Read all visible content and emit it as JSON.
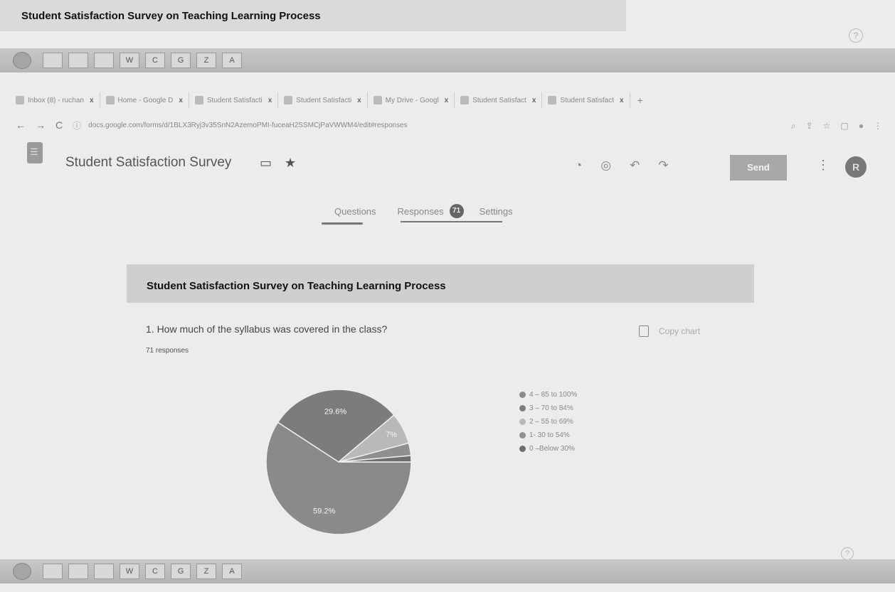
{
  "banner_title": "Student Satisfaction Survey on Teaching Learning Process",
  "taskbar": {
    "icons": [
      "",
      "",
      "",
      "W",
      "C",
      "G",
      "Z",
      "A"
    ],
    "clock": ""
  },
  "browser": {
    "tabs": [
      {
        "label": "Inbox (8) - ruchan",
        "close": "x"
      },
      {
        "label": "Home - Google D",
        "close": "x"
      },
      {
        "label": "Student Satisfacti",
        "close": "x"
      },
      {
        "label": "Student Satisfacti",
        "close": "x"
      },
      {
        "label": "My Drive - Googl",
        "close": "x"
      },
      {
        "label": "Student Satisfact",
        "close": "x"
      },
      {
        "label": "Student Satisfact",
        "close": "x"
      }
    ],
    "new_tab": "+",
    "url": "docs.google.com/forms/d/1BLX3Ryj3v35SnN2AzemoPMI-fuceaH2SSMCjPaVWWM4/edit#responses"
  },
  "form": {
    "title": "Student Satisfaction Survey",
    "send_label": "Send",
    "avatar_letter": "R"
  },
  "nav": {
    "questions": "Questions",
    "responses": "Responses",
    "responses_count": "71",
    "settings": "Settings"
  },
  "card": {
    "header": "Student Satisfaction Survey on Teaching Learning Process",
    "question": "1. How much of the syllabus was covered in the class?",
    "responses": "71 responses",
    "copy_chart": "Copy chart"
  },
  "chart_data": {
    "type": "pie",
    "slices": [
      {
        "label": "4 – 85 to 100%",
        "value": 59.2,
        "color": "#8a8a8a",
        "data_label": "59.2%"
      },
      {
        "label": "3 – 70 to 84%",
        "value": 29.6,
        "color": "#7c7c7c",
        "data_label": "29.6%"
      },
      {
        "label": "2 – 55 to 69%",
        "value": 7,
        "color": "#b9b9b9",
        "data_label": "7%"
      },
      {
        "label": "1- 30 to 54%",
        "value": 2.8,
        "color": "#8f8f8f",
        "data_label": ""
      },
      {
        "label": "0 –Below 30%",
        "value": 1.4,
        "color": "#6e6e6e",
        "data_label": ""
      }
    ],
    "legend_position": "right"
  }
}
